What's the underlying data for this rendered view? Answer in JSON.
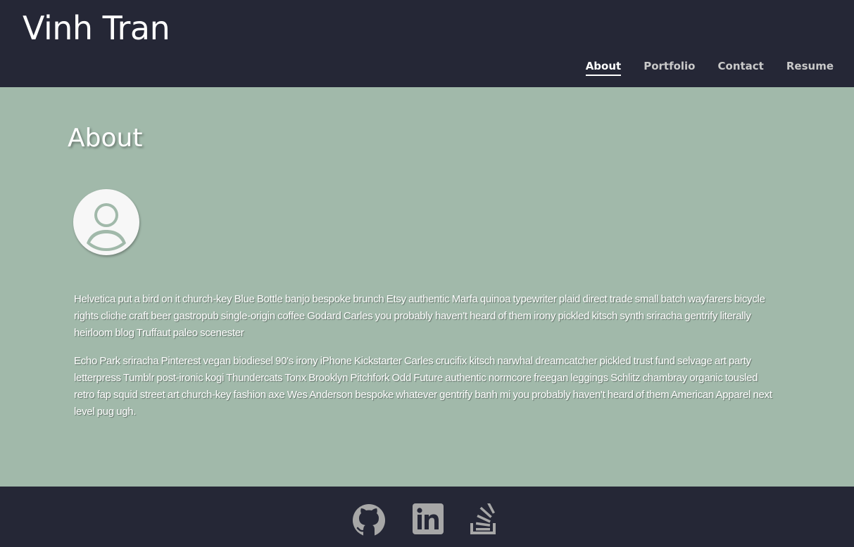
{
  "header": {
    "title": "Vinh Tran",
    "nav": [
      {
        "label": "About",
        "active": true
      },
      {
        "label": "Portfolio",
        "active": false
      },
      {
        "label": "Contact",
        "active": false
      },
      {
        "label": "Resume",
        "active": false
      }
    ]
  },
  "main": {
    "heading": "About",
    "avatar_icon": "user-avatar-icon",
    "paragraphs": [
      "Helvetica put a bird on it church-key Blue Bottle banjo bespoke brunch Etsy authentic Marfa quinoa typewriter plaid direct trade small batch wayfarers bicycle rights cliche craft beer gastropub single-origin coffee Godard Carles you probably haven't heard of them irony pickled kitsch synth sriracha gentrify literally heirloom blog Truffaut paleo scenester",
      "Echo Park sriracha Pinterest vegan biodiesel 90's irony iPhone Kickstarter Carles crucifix kitsch narwhal dreamcatcher pickled trust fund selvage art party letterpress Tumblr post-ironic kogi Thundercats Tonx Brooklyn Pitchfork Odd Future authentic normcore freegan leggings Schlitz chambray organic tousled retro fap squid street art church-key fashion axe Wes Anderson bespoke whatever gentrify banh mi you probably haven't heard of them American Apparel next level pug ugh."
    ]
  },
  "footer": {
    "social": [
      {
        "icon": "github-icon"
      },
      {
        "icon": "linkedin-icon"
      },
      {
        "icon": "stackoverflow-icon"
      }
    ]
  },
  "colors": {
    "header_bg": "#252736",
    "main_bg": "#a1b9aa",
    "icon_gray": "#a7a7a7"
  }
}
